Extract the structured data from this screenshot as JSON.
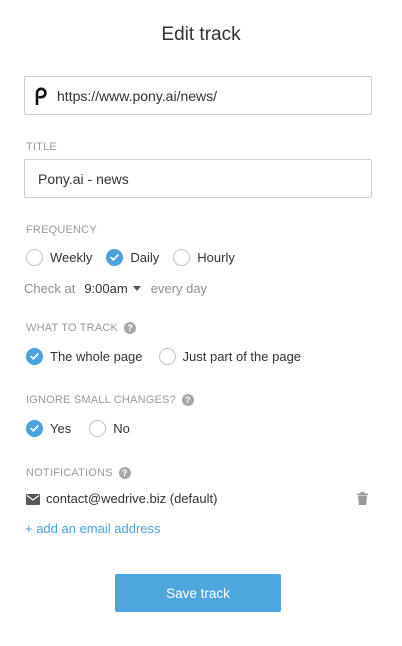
{
  "page": {
    "title": "Edit track"
  },
  "url_field": {
    "value": "https://www.pony.ai/news/",
    "icon": "pony-logo-icon"
  },
  "title_section": {
    "label": "TITLE",
    "value": "Pony.ai - news"
  },
  "frequency": {
    "label": "FREQUENCY",
    "options": [
      {
        "label": "Weekly",
        "selected": false
      },
      {
        "label": "Daily",
        "selected": true
      },
      {
        "label": "Hourly",
        "selected": false
      }
    ],
    "check_at_label": "Check at",
    "time": "9:00am",
    "every_day": "every day"
  },
  "what_to_track": {
    "label": "WHAT TO TRACK",
    "help_icon": "question-circle-icon",
    "options": [
      {
        "label": "The whole page",
        "selected": true
      },
      {
        "label": "Just part of the page",
        "selected": false
      }
    ]
  },
  "ignore_small_changes": {
    "label": "IGNORE SMALL CHANGES?",
    "help_icon": "question-circle-icon",
    "options": [
      {
        "label": "Yes",
        "selected": true
      },
      {
        "label": "No",
        "selected": false
      }
    ]
  },
  "notifications": {
    "label": "NOTIFICATIONS",
    "help_icon": "question-circle-icon",
    "email": "contact@wedrive.biz (default)",
    "add_email": "+ add an email address"
  },
  "save_button": {
    "label": "Save track"
  },
  "colors": {
    "accent": "#4aa3df",
    "muted_label": "#9a9a9a",
    "text": "#333333",
    "border": "#cfcfcf"
  }
}
